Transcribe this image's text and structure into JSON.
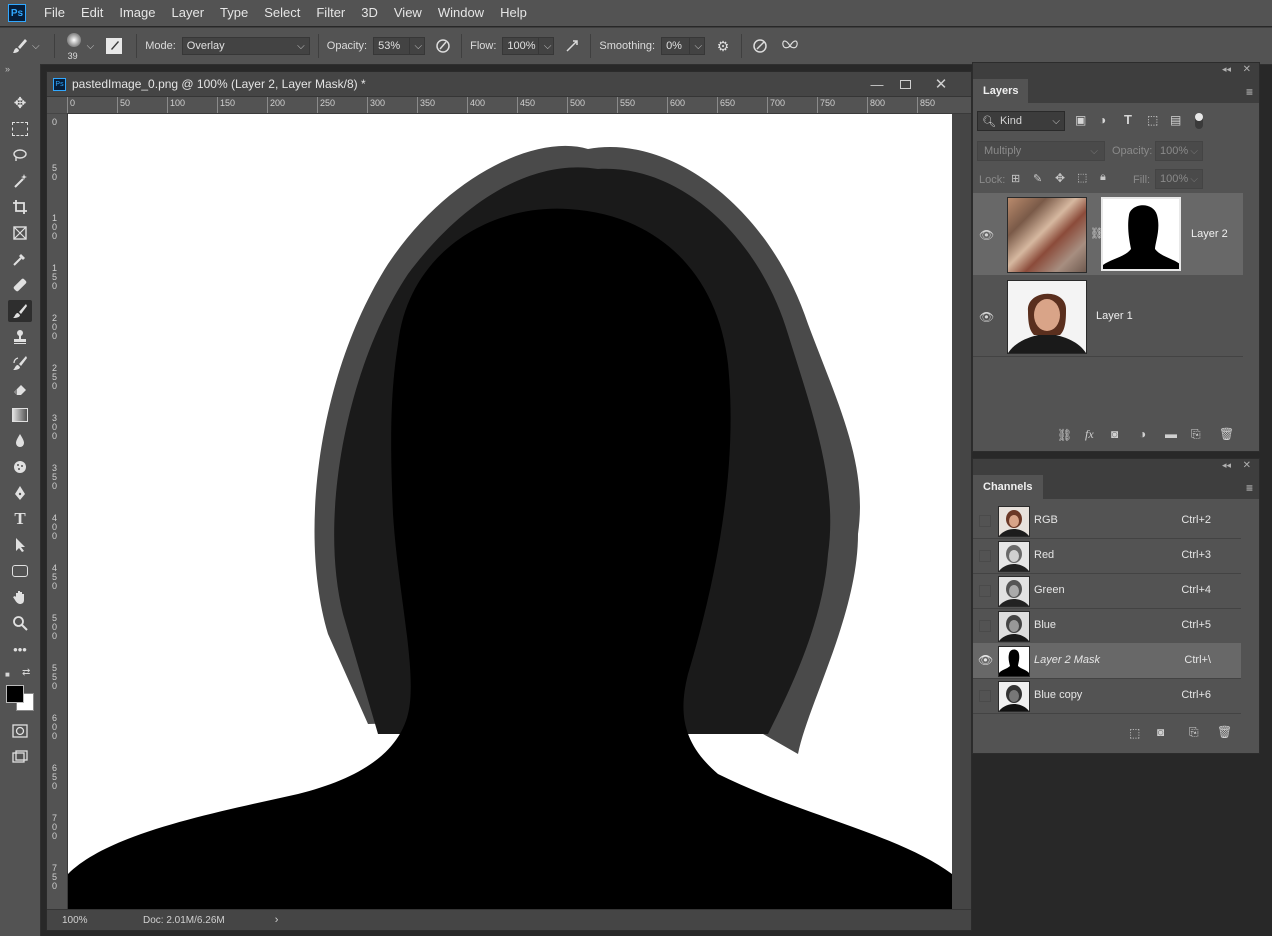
{
  "app": {
    "logo": "Ps"
  },
  "menu": [
    "File",
    "Edit",
    "Image",
    "Layer",
    "Type",
    "Select",
    "Filter",
    "3D",
    "View",
    "Window",
    "Help"
  ],
  "options": {
    "brush_size": "39",
    "mode_label": "Mode:",
    "mode_value": "Overlay",
    "opacity_label": "Opacity:",
    "opacity_value": "53%",
    "flow_label": "Flow:",
    "flow_value": "100%",
    "smoothing_label": "Smoothing:",
    "smoothing_value": "0%"
  },
  "document": {
    "title": "pastedImage_0.png @ 100% (Layer 2, Layer Mask/8) *",
    "hruler_labels": [
      "0",
      "50",
      "100",
      "150",
      "200",
      "250",
      "300",
      "350",
      "400",
      "450",
      "500",
      "550",
      "600",
      "650",
      "700",
      "750",
      "800",
      "850"
    ],
    "vruler_labels": [
      "0",
      "50",
      "100",
      "150",
      "200",
      "250",
      "300",
      "350",
      "400",
      "450",
      "500",
      "550",
      "600",
      "650",
      "700",
      "750"
    ],
    "zoom": "100%",
    "doc_info": "Doc: 2.01M/6.26M"
  },
  "layers_panel": {
    "tab": "Layers",
    "filter_kind": "Kind",
    "blend_mode": "Multiply",
    "opacity_label": "Opacity:",
    "opacity_value": "100%",
    "lock_label": "Lock:",
    "fill_label": "Fill:",
    "fill_value": "100%",
    "layers": [
      {
        "name": "Layer 2"
      },
      {
        "name": "Layer 1"
      }
    ]
  },
  "channels_panel": {
    "tab": "Channels",
    "channels": [
      {
        "name": "RGB",
        "shortcut": "Ctrl+2"
      },
      {
        "name": "Red",
        "shortcut": "Ctrl+3"
      },
      {
        "name": "Green",
        "shortcut": "Ctrl+4"
      },
      {
        "name": "Blue",
        "shortcut": "Ctrl+5"
      },
      {
        "name": "Layer 2 Mask",
        "shortcut": "Ctrl+\\"
      },
      {
        "name": "Blue copy",
        "shortcut": "Ctrl+6"
      }
    ]
  },
  "colors": {
    "foreground": "#000000",
    "background": "#ffffff",
    "accent": "#31a8ff"
  }
}
